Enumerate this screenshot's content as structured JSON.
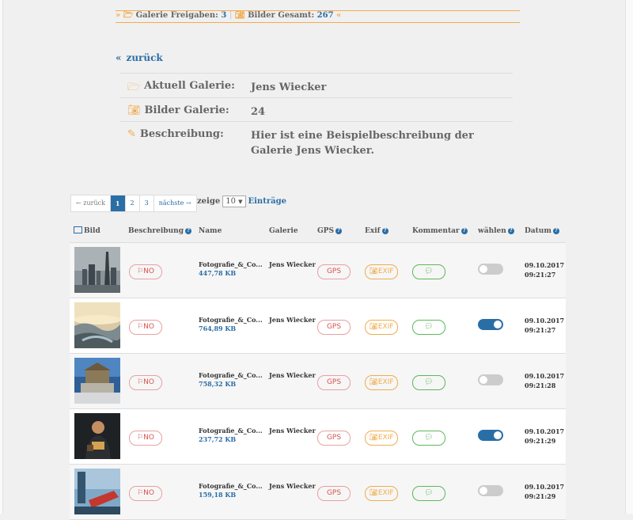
{
  "summary": {
    "freigaben_label": "Galerie Freigaben:",
    "freigaben_value": "3",
    "gesamt_label": "Bilder Gesamt:",
    "gesamt_value": "267"
  },
  "back_label": "zurück",
  "gallery_info": {
    "current_label": "Aktuell Galerie:",
    "current_value": "Jens Wiecker",
    "count_label": "Bilder Galerie:",
    "count_value": "24",
    "desc_label": "Beschreibung:",
    "desc_value": "Hier ist eine Beispielbeschreibung der Galerie Jens Wiecker."
  },
  "pagination": {
    "prev": "← zurück",
    "pages": [
      "1",
      "2",
      "3"
    ],
    "active_page": "1",
    "next": "nächste →"
  },
  "page_size": {
    "prefix": "zeige",
    "value": "10",
    "suffix": "Einträge"
  },
  "table": {
    "headers": {
      "bild": "Bild",
      "beschreibung": "Beschreibung",
      "name": "Name",
      "galerie": "Galerie",
      "gps": "GPS",
      "exif": "Exif",
      "kommentar": "Kommentar",
      "waehlen": "wählen",
      "datum": "Datum"
    },
    "badge_no": "NO",
    "badge_gps": "GPS",
    "badge_exif": "EXIF",
    "rows": [
      {
        "name": "Fotografie_&_Co...",
        "size": "447,78 KB",
        "gallery": "Jens Wiecker",
        "date": "09.10.2017",
        "time": "09:21:27",
        "selected": false
      },
      {
        "name": "Fotografie_&_Co...",
        "size": "764,89 KB",
        "gallery": "Jens Wiecker",
        "date": "09.10.2017",
        "time": "09:21:27",
        "selected": true
      },
      {
        "name": "Fotografie_&_Co...",
        "size": "758,32 KB",
        "gallery": "Jens Wiecker",
        "date": "09.10.2017",
        "time": "09:21:28",
        "selected": false
      },
      {
        "name": "Fotografie_&_Co...",
        "size": "237,72 KB",
        "gallery": "Jens Wiecker",
        "date": "09.10.2017",
        "time": "09:21:29",
        "selected": true
      },
      {
        "name": "Fotografie_&_Co...",
        "size": "159,18 KB",
        "gallery": "Jens Wiecker",
        "date": "09.10.2017",
        "time": "09:21:29",
        "selected": false
      }
    ]
  },
  "colors": {
    "accent": "#f0ad4e",
    "link": "#2a6ea6",
    "danger": "#d9534f",
    "success": "#5cb85c"
  },
  "icons": {
    "folder": "folder-open-icon",
    "camera": "camera-icon",
    "edit": "edit-icon",
    "flag": "flag-icon",
    "comment": "comment-icon",
    "help": "question-circle-icon"
  }
}
